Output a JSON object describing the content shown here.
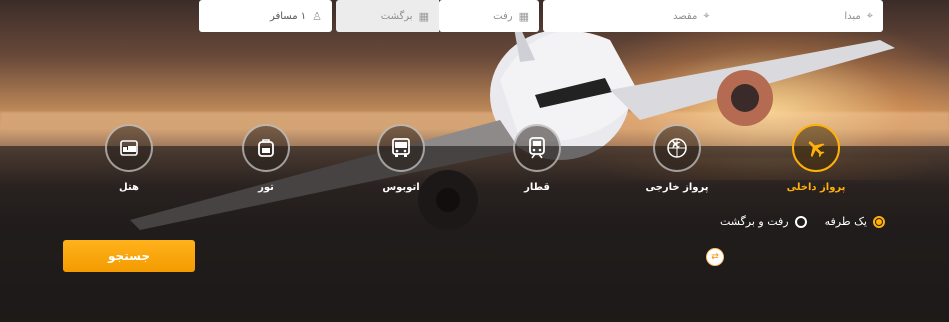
{
  "services": [
    {
      "label": "پرواز داخلی",
      "icon": "airplane-icon",
      "active": true
    },
    {
      "label": "پرواز خارجی",
      "icon": "globe-plane-icon",
      "active": false
    },
    {
      "label": "قطار",
      "icon": "train-icon",
      "active": false
    },
    {
      "label": "اتوبوس",
      "icon": "bus-icon",
      "active": false
    },
    {
      "label": "تور",
      "icon": "backpack-icon",
      "active": false
    },
    {
      "label": "هتل",
      "icon": "bed-icon",
      "active": false
    }
  ],
  "trip_type": {
    "one_way": "یک طرفه",
    "round_trip": "رفت و برگشت",
    "selected": "one_way"
  },
  "search": {
    "origin_placeholder": "مبدا",
    "destination_placeholder": "مقصد",
    "depart_placeholder": "رفت",
    "return_placeholder": "برگشت",
    "passengers_value": "۱ مسافر",
    "button_label": "جستجو"
  },
  "colors": {
    "accent": "#ffb10a",
    "button": "#f7a21a"
  }
}
